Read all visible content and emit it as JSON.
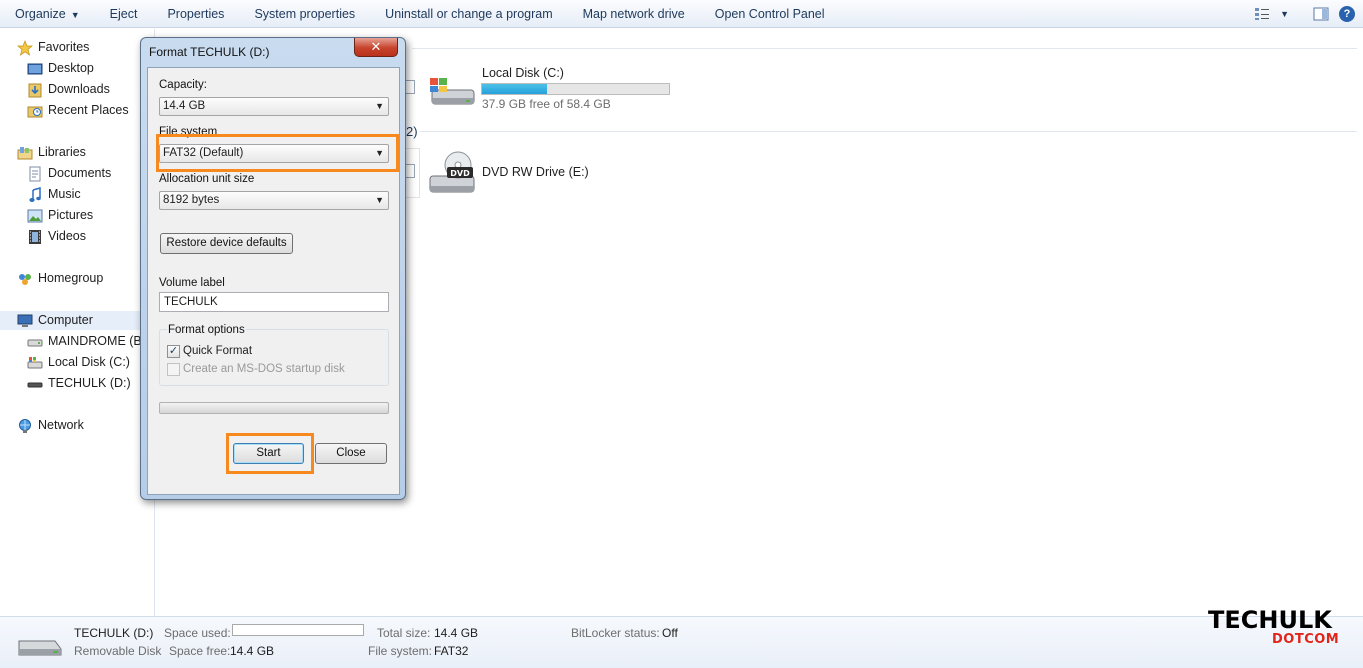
{
  "toolbar": {
    "items": [
      "Organize",
      "Eject",
      "Properties",
      "System properties",
      "Uninstall or change a program",
      "Map network drive",
      "Open Control Panel"
    ]
  },
  "nav": {
    "favorites": "Favorites",
    "desktop": "Desktop",
    "downloads": "Downloads",
    "recent_places": "Recent Places",
    "libraries": "Libraries",
    "documents": "Documents",
    "music": "Music",
    "pictures": "Pictures",
    "videos": "Videos",
    "homegroup": "Homegroup",
    "computer": "Computer",
    "maindrome": "MAINDROME (B:)",
    "local_disk": "Local Disk (C:)",
    "techulk": "TECHULK (D:)",
    "network": "Network"
  },
  "content": {
    "local_disk": {
      "name": "Local Disk (C:)",
      "free": "37.9 GB free of 58.4 GB",
      "used_fraction": 0.35
    },
    "dvd": {
      "name": "DVD RW Drive (E:)"
    },
    "section_count_fragment": "2)"
  },
  "dialog": {
    "title": "Format TECHULK (D:)",
    "close_glyph": "✕",
    "capacity_label": "Capacity:",
    "capacity_value": "14.4 GB",
    "filesystem_label": "File system",
    "filesystem_value": "FAT32 (Default)",
    "alloc_label": "Allocation unit size",
    "alloc_value": "8192 bytes",
    "restore_button": "Restore device defaults",
    "volume_label": "Volume label",
    "volume_value": "TECHULK",
    "format_options": "Format options",
    "quick_format": "Quick Format",
    "quick_format_checked": true,
    "msdos_startup": "Create an MS-DOS startup disk",
    "start_button": "Start",
    "close_button": "Close",
    "highlight_color": "#f7891f"
  },
  "details": {
    "name": "TECHULK (D:)",
    "type": "Removable Disk",
    "space_used_label": "Space used:",
    "space_free_label": "Space free:",
    "space_free_value": "14.4 GB",
    "total_size_label": "Total size:",
    "total_size_value": "14.4 GB",
    "file_system_label": "File system:",
    "file_system_value": "FAT32",
    "bitlocker_label": "BitLocker status:",
    "bitlocker_value": "Off"
  },
  "watermark": {
    "top": "TECHULK",
    "bottom": "DOTCOM"
  }
}
